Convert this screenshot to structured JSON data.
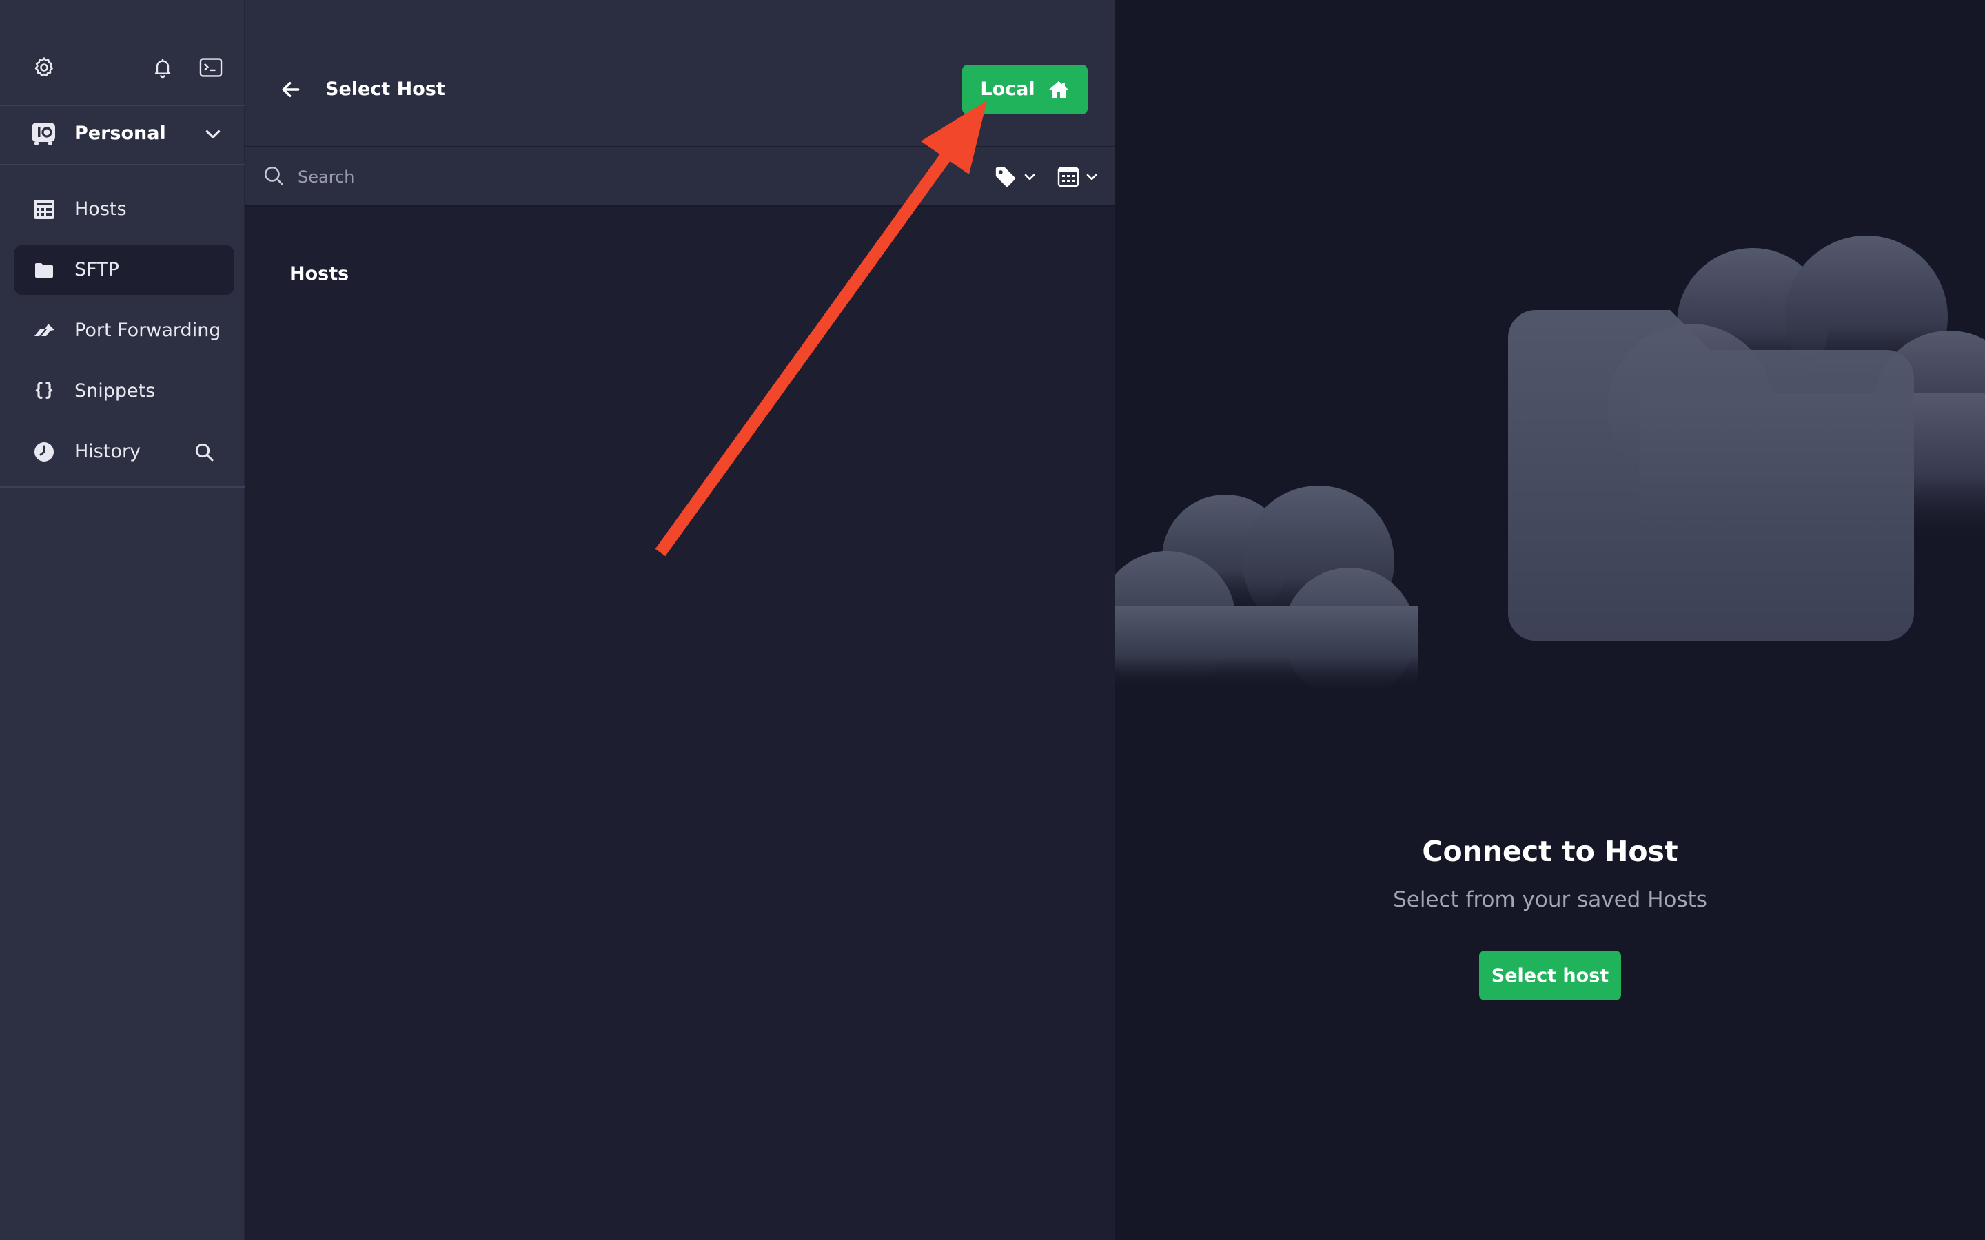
{
  "sidebar": {
    "icons": [
      "gear-icon",
      "bell-icon",
      "terminal-icon"
    ],
    "vault": {
      "name": "Personal",
      "icon": "vault-logo-icon"
    },
    "items": [
      {
        "label": "Hosts",
        "icon": "hosts-grid-icon",
        "active": false
      },
      {
        "label": "SFTP",
        "icon": "folder-icon",
        "active": true
      },
      {
        "label": "Port Forwarding",
        "icon": "port-forwarding-icon",
        "active": false
      },
      {
        "label": "Snippets",
        "icon": "braces-icon",
        "active": false
      },
      {
        "label": "History",
        "icon": "clock-icon",
        "active": false
      }
    ]
  },
  "host_picker": {
    "title": "Select Host",
    "local_button": {
      "label": "Local",
      "icon": "home-icon"
    },
    "search": {
      "placeholder": "Search",
      "value": ""
    },
    "filters": [
      "tag-filter-icon",
      "view-mode-icon"
    ],
    "section_title": "Hosts"
  },
  "empty_state": {
    "title": "Connect to Host",
    "subtitle": "Select from your saved Hosts",
    "button_label": "Select host"
  },
  "colors": {
    "accent_green": "#21b25c",
    "sidebar_bg": "#2d3042",
    "panel_bg": "#1d1f31",
    "right_bg": "#151726",
    "annotation_arrow": "#f2472a"
  }
}
